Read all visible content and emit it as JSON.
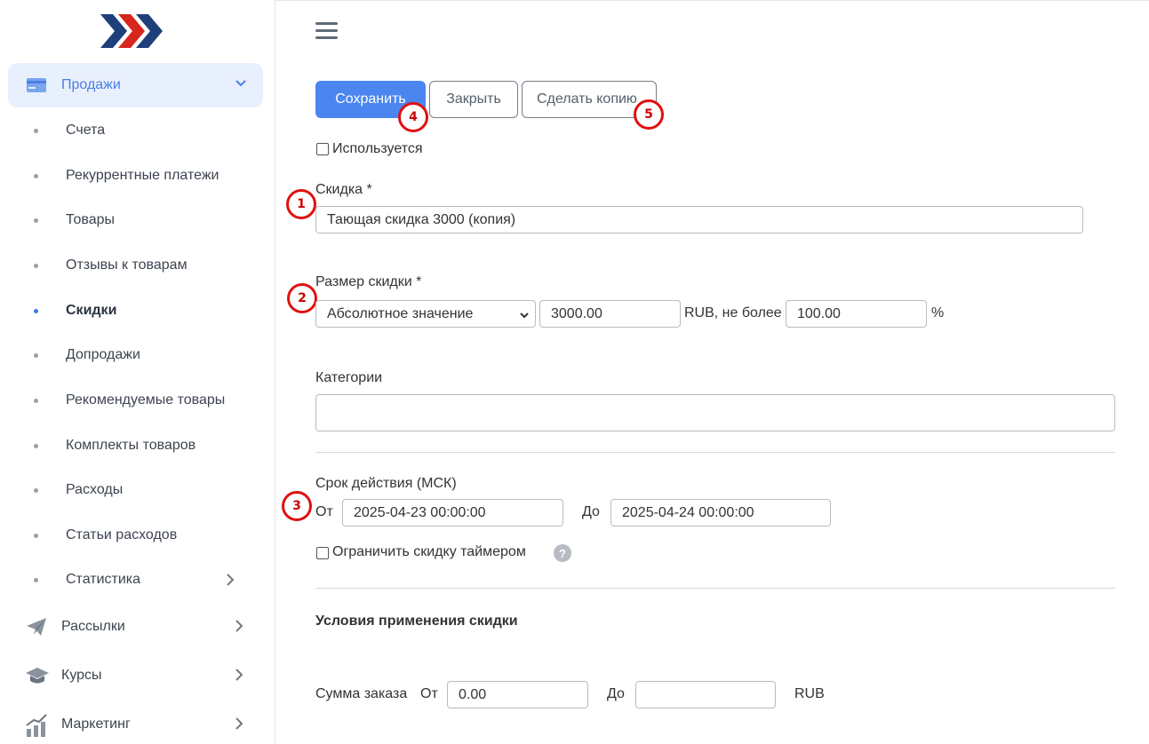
{
  "sidebar": {
    "active_section": "Продажи",
    "sub_items": [
      {
        "label": "Счета"
      },
      {
        "label": "Рекуррентные платежи"
      },
      {
        "label": "Товары"
      },
      {
        "label": "Отзывы к товарам"
      },
      {
        "label": "Скидки",
        "active": true
      },
      {
        "label": "Допродажи"
      },
      {
        "label": "Рекомендуемые товары"
      },
      {
        "label": "Комплекты товаров"
      },
      {
        "label": "Расходы"
      },
      {
        "label": "Статьи расходов"
      },
      {
        "label": "Статистика"
      }
    ],
    "main_items": [
      {
        "label": "Рассылки",
        "icon": "paper-plane-icon"
      },
      {
        "label": "Курсы",
        "icon": "graduation-cap-icon"
      },
      {
        "label": "Маркетинг",
        "icon": "bar-chart-icon"
      }
    ]
  },
  "toolbar": {
    "save_label": "Сохранить",
    "close_label": "Закрыть",
    "copy_label": "Сделать копию"
  },
  "form": {
    "used_label": "Используется",
    "discount_label": "Скидка *",
    "discount_value": "Тающая скидка 3000 (копия)",
    "size_label": "Размер скидки *",
    "size_type": "Абсолютное значение",
    "size_value": "3000.00",
    "size_suffix": "RUB, не более",
    "max_value": "100.00",
    "percent": "%",
    "categories_label": "Категории",
    "validity_label": "Срок действия (МСК)",
    "from_label": "От",
    "from_value": "2025-04-23 00:00:00",
    "to_label": "До",
    "to_value": "2025-04-24 00:00:00",
    "timer_label": "Ограничить скидку таймером",
    "help": "?",
    "conditions_heading": "Условия применения скидки",
    "order_sum_label": "Сумма заказа",
    "order_from_label": "От",
    "order_from_value": "0.00",
    "order_to_label": "До",
    "order_to_value": "",
    "order_currency": "RUB"
  },
  "annotations": [
    "1",
    "2",
    "3",
    "4",
    "5"
  ],
  "colors": {
    "primary": "#4b86f0",
    "sidebar_active_bg": "#e9f0fd",
    "annotation": "#e01010",
    "logo_dark": "#1f3f7a",
    "logo_red": "#d7261e"
  }
}
